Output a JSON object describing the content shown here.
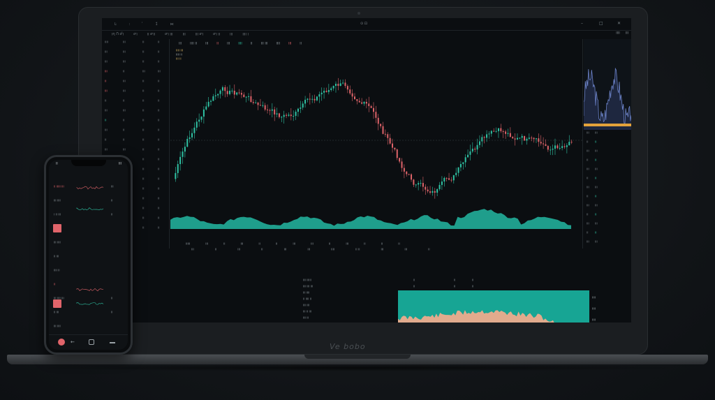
{
  "colors": {
    "up": "#2fc3a4",
    "down": "#e0646a",
    "volume_fill": "#1f9e8c",
    "depth_bg": "#17a594",
    "depth_fill": "#e1ab8d",
    "accent_line": "#e3a23a",
    "grid": "#1b2226"
  },
  "laptop": {
    "brand_label": "Ve bobo"
  },
  "screen": {
    "title": "⊙ ⊡",
    "topbar_items": [
      "Ŀ",
      "ː",
      "̓",
      "1̃",
      "⋈"
    ],
    "menubar_items": [
      "ᴉɳ ᑎ ᓂ̃ᴉ",
      "ᓂᴉ",
      "ᴉᴉ ᓂᴉᴉ",
      "ᓂᴉ ᴉᴉᴉ",
      "ᴉᴉᴉ",
      "ᴉᴉᴉ ᓂᴉ",
      "ᓂᴉ ᴉᴉ",
      "ᴉᴉᴉ",
      "ᴉᴉᴉᴉ ᴉ"
    ],
    "menu_right": [
      "ᴉᴉᴉᴉ",
      "ᴉᴉᴉ"
    ],
    "chart_toolbar": [
      {
        "text": "ᴉᴉᴉ",
        "tone": "grey"
      },
      {
        "text": "ᴉᴉᴉᴉ ᴉᴉ",
        "tone": "grey"
      },
      {
        "text": "ᴉᴉᴉ",
        "tone": "grey"
      },
      {
        "text": "ᴉᴉ",
        "tone": "red"
      },
      {
        "text": "ᴉᴉᴉ",
        "tone": "grey"
      },
      {
        "text": "ᴉᴉᴉᴉ",
        "tone": "green"
      },
      {
        "text": "ᴉᴉ",
        "tone": "grey"
      },
      {
        "text": "ᴉᴉᴉ ᴉᴉᴉ",
        "tone": "grey"
      },
      {
        "text": "ᴉᴉᴉᴉ",
        "tone": "grey"
      },
      {
        "text": "ᴉᴉᴉ",
        "tone": "red"
      },
      {
        "text": "ᴉᴉ",
        "tone": "grey"
      }
    ],
    "chart_legend": [
      "ᴉᴉᴉᴉ ᴉᴉᴉ",
      "ᴉᴉᴉᴉ ᴉᴉ",
      "ᴉᴉᴉ ᴉᴉ"
    ],
    "bottom_axis": [
      "ᴉᴉᴉᴉᴉ",
      "ᴉᴉᴉ",
      "ᴉᴉ",
      "ᴉᴉᴉ",
      "ᴉᴉ",
      "ᴉᴉ",
      "ᴉᴉᴉ",
      "ᴉᴉᴉ",
      "ᴉᴉ",
      "ᴉᴉᴉ",
      "ᴉᴉ",
      "ᴉᴉ",
      "ᴉᴉ"
    ],
    "lower_tabs": [
      "ᴉᴉᴉ",
      "ᴉᴉ",
      "ᴉᴉᴉ",
      "ᴉᴉ",
      "ᴉᴉᴉ",
      "ᴉᴉᴉ",
      "ᴉᴉᴉᴉ",
      "ᴉᴉ ᴉᴉ",
      "ᴉᴉᴉ",
      "ᴉᴉᴉ",
      "ᴉᴉ"
    ],
    "left_rows": [
      {
        "a": "ᴉᴉᴉᴉ",
        "b": "ᴉᴉᴉ",
        "c": "ᴉᴉ",
        "tone": "grey"
      },
      {
        "a": "ᴉᴉᴉ",
        "b": "ᴉᴉᴉ",
        "c": "ᴉᴉ",
        "tone": "grey"
      },
      {
        "a": "ᴉᴉᴉ",
        "b": "ᴉᴉᴉ",
        "c": "ᴉᴉ",
        "tone": "grey"
      },
      {
        "a": "ᴉᴉᴉ",
        "b": "ᴉᴉ",
        "c": "ᴉᴉᴉ",
        "tone": "red"
      },
      {
        "a": "ᴉᴉ",
        "b": "ᴉᴉᴉ",
        "c": "ᴉᴉ",
        "tone": "red"
      },
      {
        "a": "ᴉᴉᴉ",
        "b": "ᴉᴉᴉ",
        "c": "ᴉᴉ",
        "tone": "red"
      },
      {
        "a": "ᴉᴉ",
        "b": "ᴉᴉ",
        "c": "ᴉᴉ",
        "tone": "grey"
      },
      {
        "a": "ᴉᴉᴉ",
        "b": "ᴉᴉᴉ",
        "c": "ᴉᴉ",
        "tone": "grey"
      },
      {
        "a": "ᴉᴉ",
        "b": "ᴉᴉ",
        "c": "ᴉᴉ",
        "tone": "green"
      },
      {
        "a": "ᴉᴉᴉ",
        "b": "ᴉᴉ",
        "c": "ᴉᴉ",
        "tone": "grey"
      },
      {
        "a": "ᴉᴉ",
        "b": "ᴉᴉ",
        "c": "ᴉᴉ",
        "tone": "grey"
      },
      {
        "a": "ᴉᴉᴉ",
        "b": "ᴉᴉᴉ",
        "c": "ᴉᴉ",
        "tone": "grey"
      },
      {
        "a": "ᴉᴉ",
        "b": "ᴉᴉ",
        "c": "ᴉᴉ",
        "tone": "grey"
      },
      {
        "a": "ᴉᴉᴉ",
        "b": "ᴉᴉ",
        "c": "ᴉᴉ",
        "tone": "grey"
      },
      {
        "a": "ᴉᴉ",
        "b": "ᴉᴉᴉ",
        "c": "ᴉᴉ",
        "tone": "grey"
      },
      {
        "a": "ᴉᴉᴉ",
        "b": "ᴉᴉ",
        "c": "ᴉᴉ",
        "tone": "grey"
      },
      {
        "a": "ᴉᴉ",
        "b": "ᴉᴉ",
        "c": "ᴉᴉ",
        "tone": "grey"
      },
      {
        "a": "ᴉᴉᴉ",
        "b": "ᴉᴉ",
        "c": "ᴉᴉ",
        "tone": "grey"
      },
      {
        "a": "ᴉᴉ",
        "b": "ᴉᴉ",
        "c": "ᴉᴉ",
        "tone": "grey"
      },
      {
        "a": "ᴉᴉᴉ",
        "b": "ᴉᴉ",
        "c": "ᴉᴉ",
        "tone": "grey"
      }
    ],
    "right_rows": [
      "ᴉᴉᴉ",
      "ᴉᴉ",
      "ᴉᴉᴉ",
      "ᴉᴉ",
      "ᴉᴉᴉ",
      "ᴉᴉ",
      "ᴉᴉᴉ",
      "ᴉᴉ",
      "ᴉᴉᴉ",
      "ᴉᴉ",
      "ᴉᴉᴉ",
      "ᴉᴉ",
      "ᴉᴉᴉ"
    ],
    "order_rows": [
      {
        "a": "ᴉᴉᴉᴉ ᴉᴉᴉᴉᴉ",
        "b": "ᴉᴉ",
        "c": "ᴉᴉ",
        "d": "ᴉᴉ"
      },
      {
        "a": "ᴉᴉᴉᴉ ᴉᴉᴉ ᴉᴉᴉ",
        "b": "ᴉᴉ",
        "c": "ᴉᴉ",
        "d": "ᴉᴉ"
      },
      {
        "a": "ᴉᴉᴉ ᴉᴉᴉᴉ",
        "b": "ᴉᴉ",
        "c": "ᴉᴉ",
        "d": "ᴉᴉ"
      },
      {
        "a": "ᴉᴉ ᴉᴉᴉᴉ ᴉᴉ",
        "b": "ᴉᴉ",
        "c": "ᴉᴉ",
        "d": "ᴉᴉ"
      },
      {
        "a": "ᴉᴉᴉᴉ ᴉᴉᴉ",
        "b": "ᴉᴉ",
        "c": "ᴉᴉ",
        "d": "ᴉᴉ"
      },
      {
        "a": "ᴉᴉᴉ ᴉᴉ ᴉᴉᴉ",
        "b": "ᴉᴉ",
        "c": "ᴉᴉ",
        "d": "ᴉᴉ"
      },
      {
        "a": "ᴉᴉᴉᴉ ᴉᴉ",
        "b": "ᴉᴉ",
        "c": "ᴉᴉ",
        "d": "ᴉᴉ"
      },
      {
        "a": "ᴉᴉᴉ ᴉᴉᴉ",
        "b": "ᴉᴉ",
        "c": "ᴉᴉ",
        "d": "ᴉᴉ"
      },
      {
        "a": "ᴉᴉᴉᴉ ᴉᴉᴉ",
        "b": "ᴉᴉ",
        "c": "ᴉᴉ",
        "d": "ᴉᴉ"
      }
    ],
    "depth_axis": [
      "ᴉᴉᴉᴉ",
      "ᴉᴉᴉᴉ",
      "ᴉᴉᴉᴉ",
      "ᴉᴉᴉ"
    ]
  },
  "phone": {
    "time": "ᴉᴉ",
    "status": "ᴉᴉᴉ",
    "rows": [
      {
        "a": "ᴉᴉ ᴉᴉᴉᴉᴉ ᴉᴉᴉ",
        "b": "ᴉᴉᴉ",
        "tone": "red"
      },
      {
        "a": "ᴉᴉᴉ ᴉᴉᴉᴉ",
        "b": "ᴉᴉ",
        "tone": "grey"
      },
      {
        "a": "ᴉ ᴉᴉ ᴉᴉᴉ",
        "b": "ᴉᴉ",
        "tone": "grey"
      },
      {
        "a": "ᴉᴉ ᴉᴉᴉ",
        "b": "",
        "tone": "red"
      },
      {
        "a": "ᴉᴉᴉ ᴉᴉᴉᴉ",
        "b": "",
        "tone": "grey"
      },
      {
        "a": "ᴉᴉ ᴉᴉᴉ",
        "b": "",
        "tone": "grey"
      },
      {
        "a": "ᴉᴉᴉᴉ ᴉᴉ",
        "b": "",
        "tone": "grey"
      },
      {
        "a": "ᴉᴉ",
        "b": "",
        "tone": "red"
      },
      {
        "a": "ᴉᴉᴉ ᴉᴉᴉᴉ ᴉᴉᴉ",
        "b": "ᴉᴉ",
        "tone": "grey"
      },
      {
        "a": "ᴉᴉ ᴉᴉᴉ",
        "b": "ᴉᴉ",
        "tone": "grey"
      },
      {
        "a": "ᴉᴉᴉ ᴉᴉᴉᴉ",
        "b": "",
        "tone": "grey"
      }
    ]
  }
}
